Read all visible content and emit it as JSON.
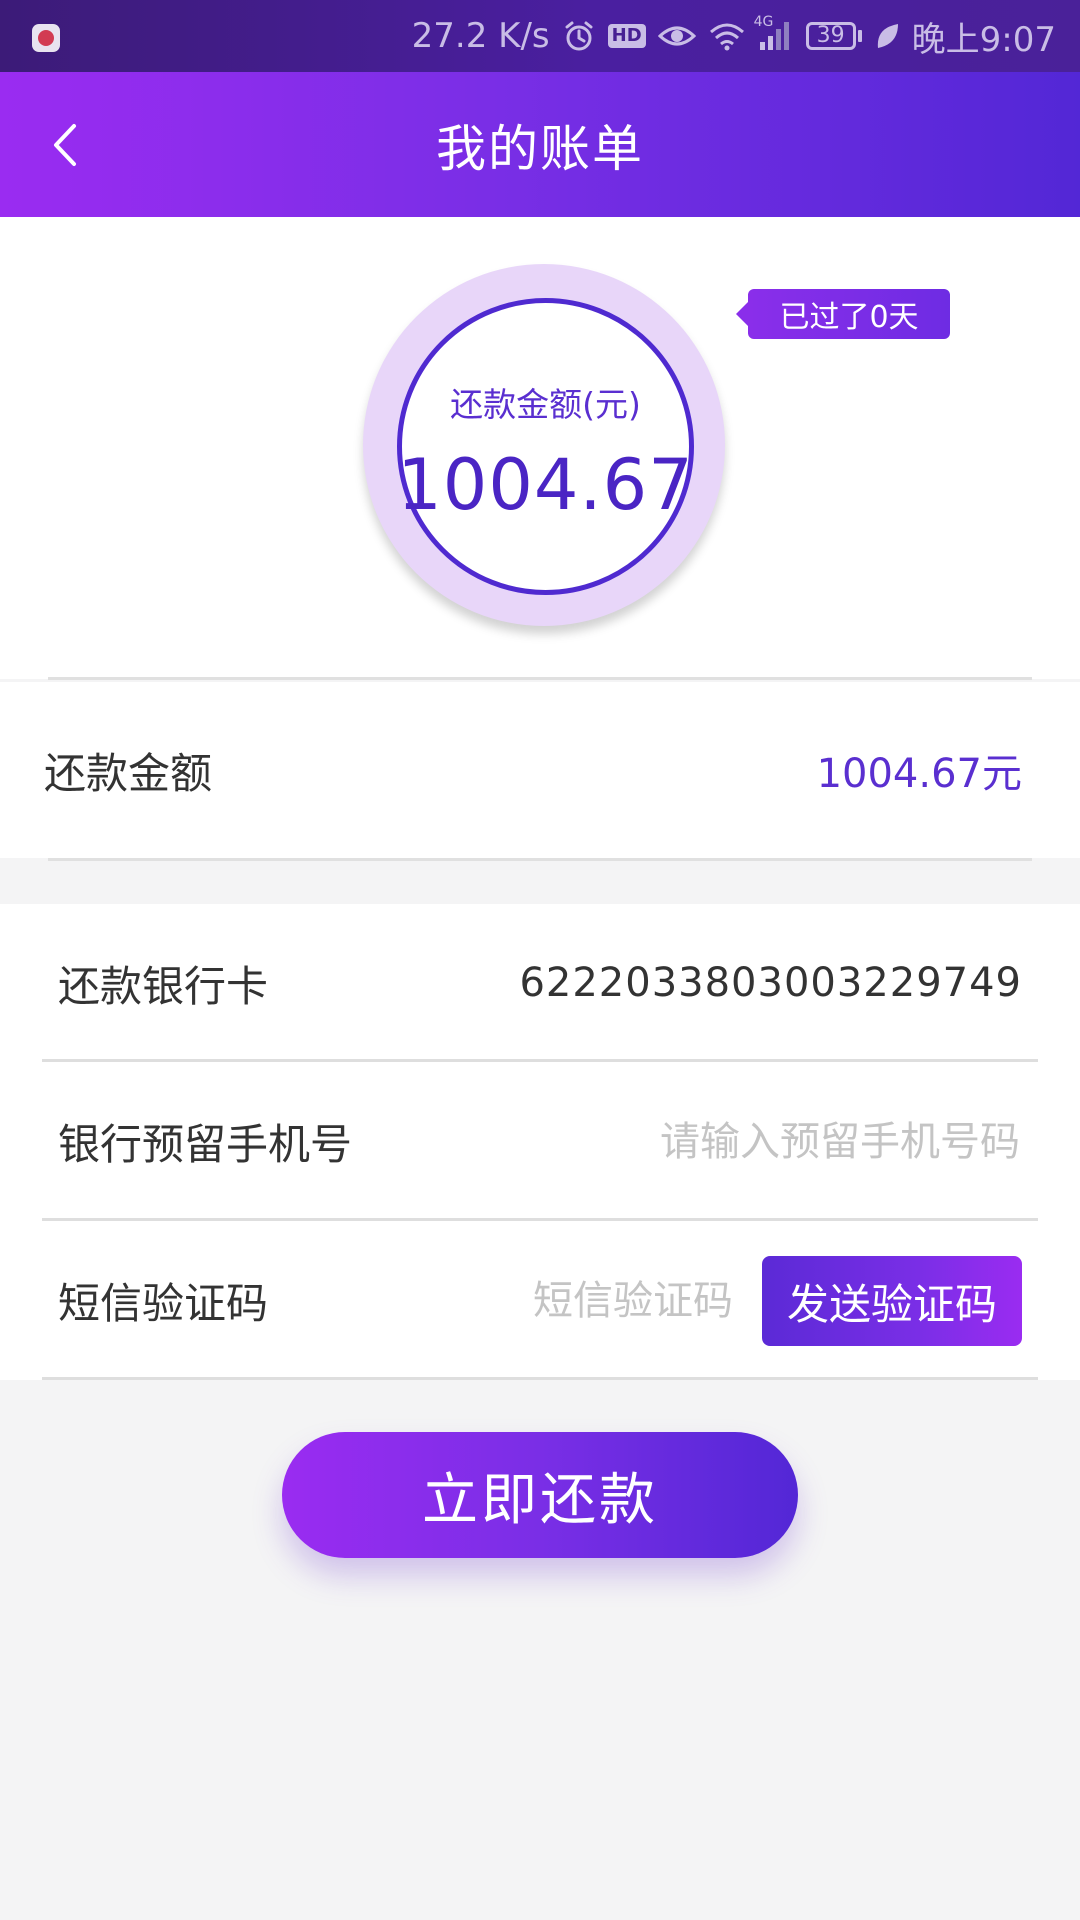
{
  "status_bar": {
    "network_speed": "27.2 K/s",
    "hd_badge": "HD",
    "network_type": "4G",
    "battery_level": "39",
    "time": "晚上9:07",
    "icons": [
      "app-notification-icon",
      "alarm-icon",
      "hd-icon",
      "eye-icon",
      "wifi-icon",
      "signal-icon",
      "battery-icon",
      "leaf-icon"
    ]
  },
  "header": {
    "title": "我的账单",
    "back_icon": "chevron-left-icon"
  },
  "summary": {
    "circle_label": "还款金额(元)",
    "circle_amount": "1004.67",
    "overdue_badge": "已过了0天"
  },
  "amount_row": {
    "label": "还款金额",
    "value": "1004.67元"
  },
  "form": {
    "bank_card": {
      "label": "还款银行卡",
      "value": "6222033803003229749"
    },
    "phone": {
      "label": "银行预留手机号",
      "value": "",
      "placeholder": "请输入预留手机号码"
    },
    "sms_code": {
      "label": "短信验证码",
      "value": "",
      "placeholder": "短信验证码",
      "send_button": "发送验证码"
    }
  },
  "submit_button": "立即还款",
  "colors": {
    "primary_start": "#9a2cf1",
    "primary_end": "#5327d6",
    "accent_text": "#5a2fd0",
    "circle_ring_bg": "#e8d6f9",
    "page_bg": "#f4f4f5"
  }
}
